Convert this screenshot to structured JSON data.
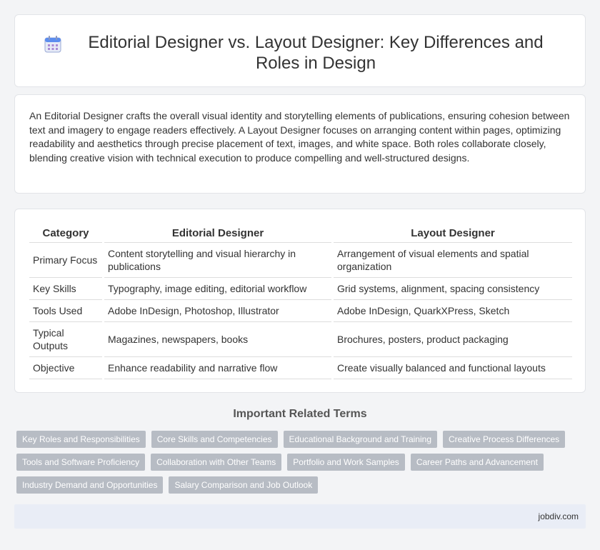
{
  "header": {
    "title": "Editorial Designer vs. Layout Designer: Key Differences and Roles in Design",
    "icon": "calendar-icon"
  },
  "intro": {
    "text": "An Editorial Designer crafts the overall visual identity and storytelling elements of publications, ensuring cohesion between text and imagery to engage readers effectively. A Layout Designer focuses on arranging content within pages, optimizing readability and aesthetics through precise placement of text, images, and white space. Both roles collaborate closely, blending creative vision with technical execution to produce compelling and well-structured designs."
  },
  "table": {
    "headers": [
      "Category",
      "Editorial Designer",
      "Layout Designer"
    ],
    "rows": [
      [
        "Primary Focus",
        "Content storytelling and visual hierarchy in publications",
        "Arrangement of visual elements and spatial organization"
      ],
      [
        "Key Skills",
        "Typography, image editing, editorial workflow",
        "Grid systems, alignment, spacing consistency"
      ],
      [
        "Tools Used",
        "Adobe InDesign, Photoshop, Illustrator",
        "Adobe InDesign, QuarkXPress, Sketch"
      ],
      [
        "Typical Outputs",
        "Magazines, newspapers, books",
        "Brochures, posters, product packaging"
      ],
      [
        "Objective",
        "Enhance readability and narrative flow",
        "Create visually balanced and functional layouts"
      ]
    ]
  },
  "related": {
    "title": "Important Related Terms",
    "tags": [
      "Key Roles and Responsibilities",
      "Core Skills and Competencies",
      "Educational Background and Training",
      "Creative Process Differences",
      "Tools and Software Proficiency",
      "Collaboration with Other Teams",
      "Portfolio and Work Samples",
      "Career Paths and Advancement",
      "Industry Demand and Opportunities",
      "Salary Comparison and Job Outlook"
    ]
  },
  "footer": {
    "site": "jobdiv.com"
  },
  "colors": {
    "tag_bg": "#b7bcc4",
    "footer_bg": "#e9edf6",
    "icon_accent": "#5b8def"
  }
}
